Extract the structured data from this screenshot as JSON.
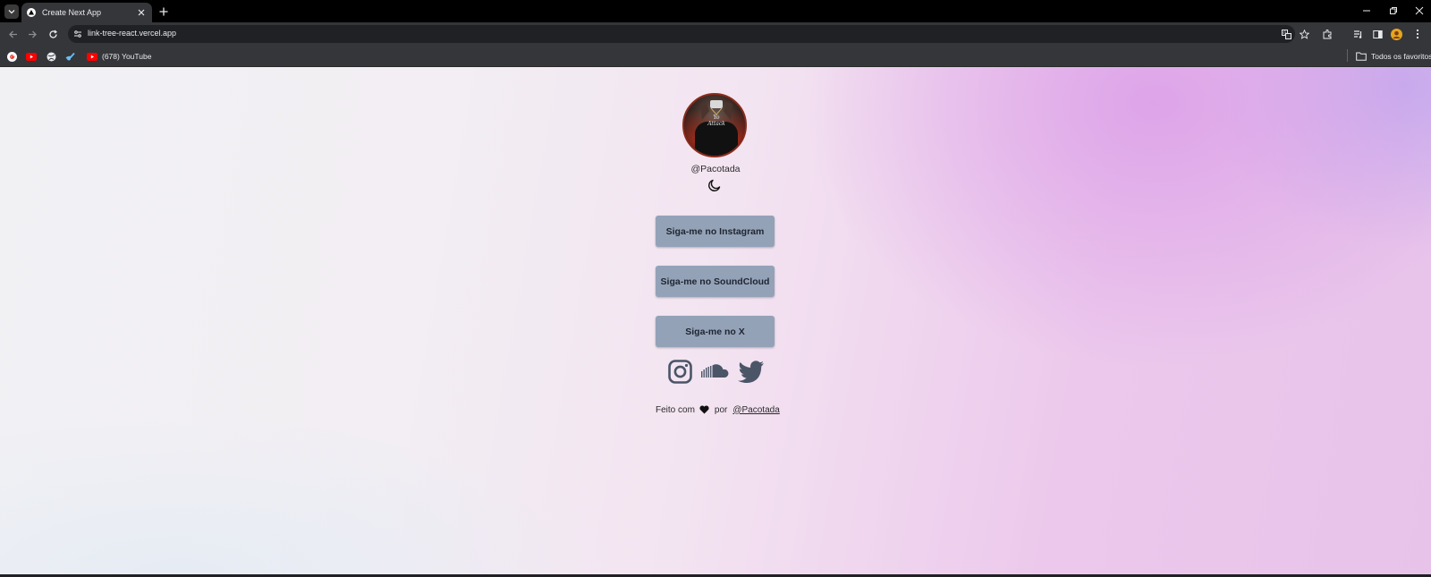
{
  "browser": {
    "tab": {
      "title": "Create Next App",
      "favicon": "triangle-icon"
    },
    "omnibox": {
      "url": "link-tree-react.vercel.app"
    },
    "bookmarks": [
      {
        "icon": "google-icon",
        "label": ""
      },
      {
        "icon": "youtube-icon",
        "label": ""
      },
      {
        "icon": "globe-icon",
        "label": ""
      },
      {
        "icon": "steam-icon",
        "label": ""
      },
      {
        "icon": "youtube-icon",
        "label": "(678) YouTube"
      }
    ],
    "all_bookmarks_label": "Todos os favoritos"
  },
  "profile": {
    "username": "@Pacotada",
    "avatar_text": "Yo Attack"
  },
  "links": [
    {
      "label": "Siga-me no Instagram"
    },
    {
      "label": "Siga-me no SoundCloud"
    },
    {
      "label": "Siga-me no X"
    }
  ],
  "socials": [
    {
      "icon": "instagram-icon"
    },
    {
      "icon": "soundcloud-icon"
    },
    {
      "icon": "twitter-icon"
    }
  ],
  "footer": {
    "prefix": "Feito com",
    "middle": "por",
    "author": "@Pacotada"
  },
  "colors": {
    "button_bg": "#94a2b8",
    "button_text": "#1e2530",
    "chrome_bg": "#35363a"
  }
}
